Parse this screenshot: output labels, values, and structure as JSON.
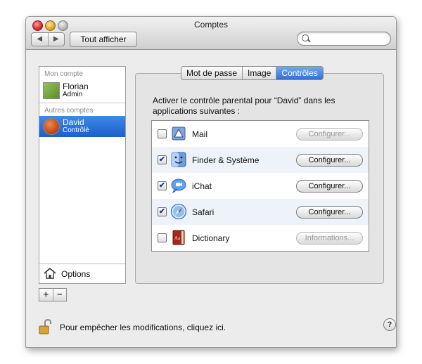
{
  "window": {
    "title": "Comptes"
  },
  "toolbar": {
    "back_label": "◀",
    "forward_label": "▶",
    "show_all_label": "Tout afficher",
    "search_placeholder": "",
    "search_value": ""
  },
  "accounts": {
    "my_account_header": "Mon compte",
    "my_account": {
      "name": "Florian",
      "role": "Admin"
    },
    "other_accounts_header": "Autres comptes",
    "others": [
      {
        "name": "David",
        "role": "Contrôlé"
      }
    ],
    "options_label": "Options",
    "add_label": "+",
    "remove_label": "−"
  },
  "tabs": [
    {
      "label": "Mot de passe"
    },
    {
      "label": "Image"
    },
    {
      "label": "Contrôles"
    }
  ],
  "controls": {
    "description": "Activer le contrôle parental pour “David” dans les applications suivantes :",
    "apps": [
      {
        "name": "Mail",
        "checked": false,
        "button": "Configurer...",
        "button_enabled": false,
        "icon": "mail-icon"
      },
      {
        "name": "Finder & Système",
        "checked": true,
        "button": "Configurer...",
        "button_enabled": true,
        "icon": "finder-icon"
      },
      {
        "name": "iChat",
        "checked": true,
        "button": "Configurer...",
        "button_enabled": true,
        "icon": "ichat-icon"
      },
      {
        "name": "Safari",
        "checked": true,
        "button": "Configurer...",
        "button_enabled": true,
        "icon": "safari-icon"
      },
      {
        "name": "Dictionary",
        "checked": false,
        "button": "Informations...",
        "button_enabled": false,
        "icon": "dictionary-icon"
      }
    ],
    "check_mark": "✔"
  },
  "footer": {
    "lock_text": "Pour empêcher les modifications, cliquez ici.",
    "help_label": "?"
  }
}
